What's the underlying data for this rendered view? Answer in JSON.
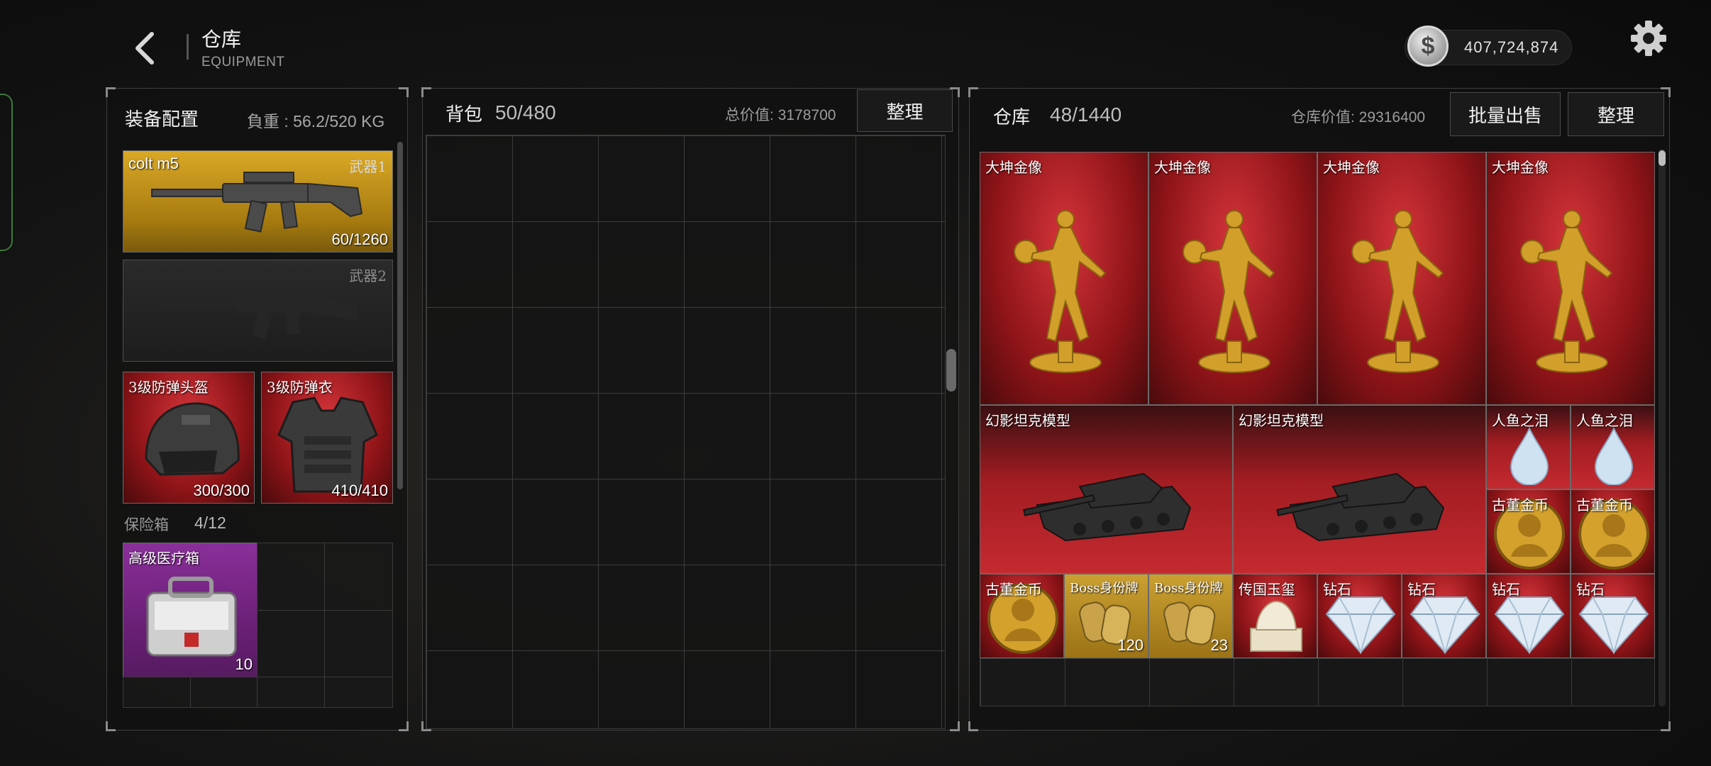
{
  "header": {
    "title": "仓库",
    "subtitle": "EQUIPMENT",
    "currency_value": "407,724,874"
  },
  "loadout": {
    "title": "装备配置",
    "weight": "負重 : 56.2/520 KG",
    "weapon1": {
      "name": "colt m5",
      "tag": "武器1",
      "count": "60/1260"
    },
    "weapon2": {
      "tag": "武器2"
    },
    "helmet": {
      "name": "3级防弹头盔",
      "count": "300/300"
    },
    "armor": {
      "name": "3级防弹衣",
      "count": "410/410"
    },
    "safebox": {
      "label": "保险箱",
      "capacity": "4/12"
    },
    "medkit": {
      "name": "高级医疗箱",
      "count": "10"
    }
  },
  "backpack": {
    "title": "背包",
    "capacity": "50/480",
    "total_value": "总价值: 3178700",
    "sort_label": "整理"
  },
  "warehouse": {
    "title": "仓库",
    "capacity": "48/1440",
    "value": "仓库价值: 29316400",
    "bulk_sell_label": "批量出售",
    "sort_label": "整理",
    "items": {
      "statue": "大坤金像",
      "tank": "幻影坦克模型",
      "tear": "人鱼之泪",
      "coin": "古董金币",
      "boss_tag": "Boss身份牌",
      "boss_count_1": "120",
      "boss_count_2": "23",
      "seal": "传国玉玺",
      "diamond": "钻石"
    }
  },
  "colors": {
    "gold_slot": "#c4941c",
    "red_slot": "#b0242a",
    "purple_slot": "#7a2788"
  }
}
